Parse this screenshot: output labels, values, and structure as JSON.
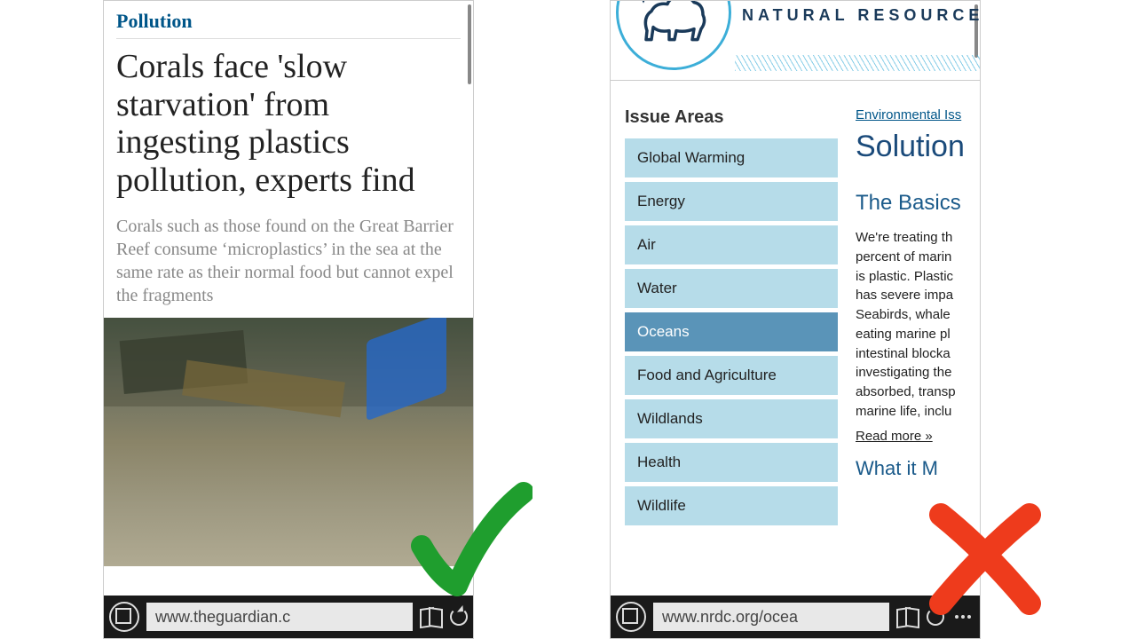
{
  "left": {
    "category": "Pollution",
    "headline": "Corals face 'slow starvation' from ingesting plastics pollution, experts find",
    "standfirst": "Corals such as those found on the Great Barrier Reef consume ‘microplastics’ in the sea at the same rate as their normal food but cannot expel the fragments",
    "url": "www.theguardian.c"
  },
  "right": {
    "org_title": "NATURAL RESOURCES D",
    "sidebar_heading": "Issue Areas",
    "menu": [
      {
        "label": "Global Warming",
        "selected": false
      },
      {
        "label": "Energy",
        "selected": false
      },
      {
        "label": "Air",
        "selected": false
      },
      {
        "label": "Water",
        "selected": false
      },
      {
        "label": "Oceans",
        "selected": true
      },
      {
        "label": "Food and Agriculture",
        "selected": false
      },
      {
        "label": "Wildlands",
        "selected": false
      },
      {
        "label": "Health",
        "selected": false
      },
      {
        "label": "Wildlife",
        "selected": false
      }
    ],
    "breadcrumb": "Environmental Iss",
    "page_title": "Solution",
    "section_heading": "The Basics",
    "body_lines": [
      "We're treating th",
      "percent of marin",
      "is plastic. Plastic",
      "has severe impa",
      "Seabirds, whale",
      "eating marine pl",
      "intestinal blocka",
      "investigating the",
      "absorbed, transp",
      "marine life, inclu"
    ],
    "read_more": "Read more »",
    "next_heading": "What it M",
    "url": "www.nrdc.org/ocea"
  }
}
